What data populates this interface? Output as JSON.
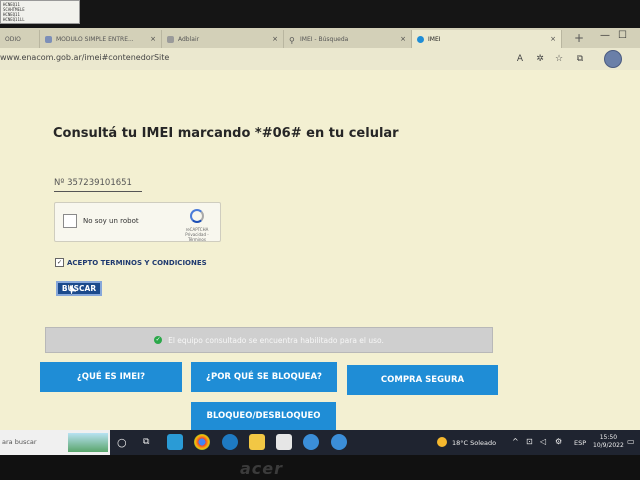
{
  "sticker": {
    "lines": [
      "HCNEQ11",
      "SCAHTMELE",
      "HCNEQ11",
      "HCNEQ11LL"
    ]
  },
  "browser": {
    "tabs": [
      {
        "label": "ODIO"
      },
      {
        "label": "MODULO SIMPLE ENTRE..."
      },
      {
        "label": "Adblair"
      },
      {
        "label": "IMEI - Búsqueda"
      },
      {
        "label": "IMEI",
        "active": true
      }
    ],
    "new_tab_label": "+",
    "url": "www.enacom.gob.ar/imei#contenedorSite",
    "controls": {
      "minimize": "—",
      "maximize": "☐",
      "close": "✕"
    }
  },
  "page": {
    "title": "Consultá tu IMEI marcando *#06# en tu celular",
    "imei_input": {
      "value": "Nº 357239101651",
      "placeholder": "Nº"
    },
    "captcha": {
      "label": "No soy un robot",
      "brand": "reCAPTCHA",
      "links": "Privacidad - Términos"
    },
    "terms": {
      "label": "ACEPTO TERMINOS Y CONDICIONES",
      "checked": true
    },
    "search_button": "BUSCAR",
    "result": {
      "message": "El equipo consultado se encuentra habilitado para el uso."
    },
    "nav_buttons": [
      {
        "label": "¿QUÉ ES IMEI?"
      },
      {
        "label": "¿POR QUÉ SE BLOQUEA?"
      },
      {
        "label": "COMPRA SEGURA"
      },
      {
        "label": "BLOQUEO/DESBLOQUEO"
      }
    ]
  },
  "taskbar": {
    "search_placeholder": "ara buscar",
    "weather": "18°C  Soleado",
    "language": "ESP",
    "time": "15:50",
    "date": "10/9/2022"
  },
  "hardware": {
    "brand": "acer"
  },
  "colors": {
    "accent": "#1f8dd6",
    "button": "#1b4a8c",
    "page_bg": "#f3f0d2"
  }
}
